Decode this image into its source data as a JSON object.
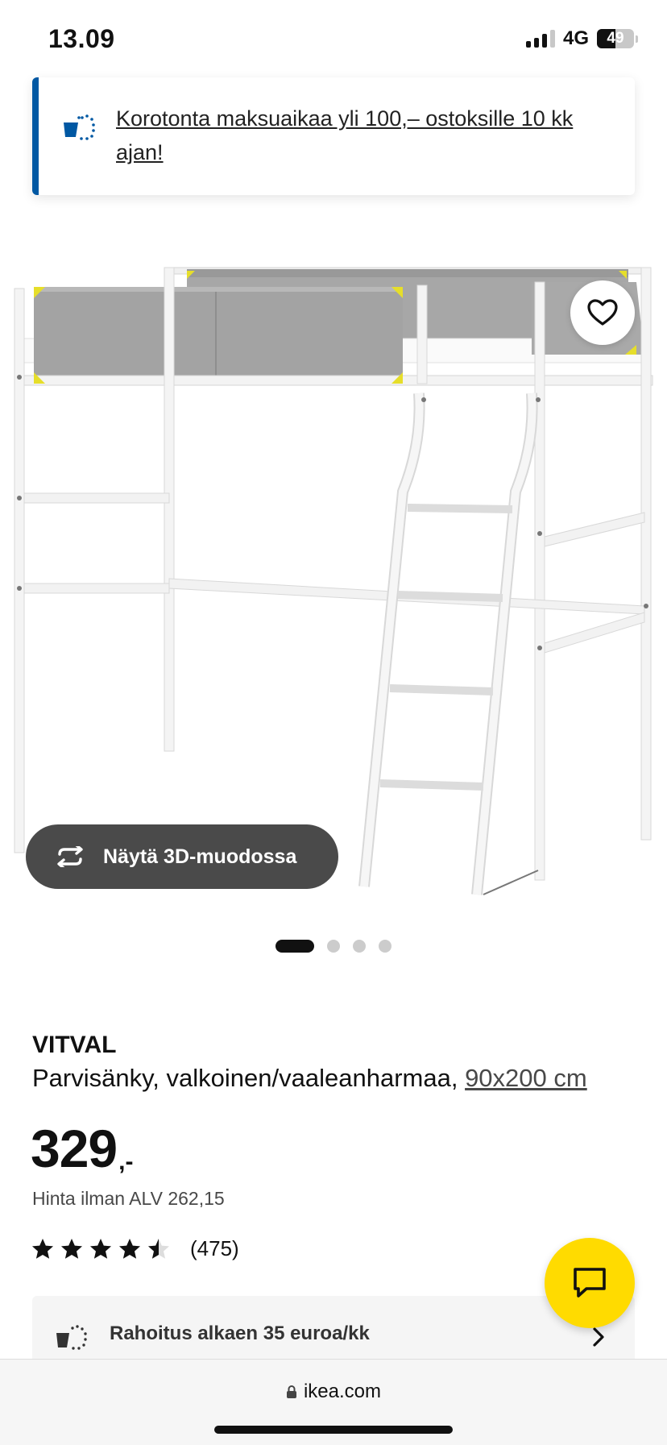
{
  "status_bar": {
    "time": "13.09",
    "network": "4G",
    "battery_level": "49",
    "battery_fraction": 0.49
  },
  "promo_banner": {
    "text": "Korotonta maksuaikaa yli 100,– ostoksille 10 kk ajan!",
    "icon": "payment-plan-icon",
    "accent_color": "#0058a3"
  },
  "product_image": {
    "favorite_icon": "heart-icon",
    "view_3d_label": "Näytä 3D-muodossa",
    "view_3d_icon": "rotate-3d-icon",
    "carousel": {
      "count": 4,
      "active_index": 0
    }
  },
  "product": {
    "name": "VITVAL",
    "description": "Parvisänky, valkoinen/vaaleanharmaa, ",
    "size_link": "90x200 cm",
    "price_main": "329",
    "price_suffix": ",-",
    "price_vat": "Hinta ilman ALV 262,15",
    "rating_value": 4.5,
    "rating_max": 5,
    "rating_count": "(475)"
  },
  "financing": {
    "label": "Rahoitus alkaen 35 euroa/kk",
    "icon": "payment-plan-icon"
  },
  "chat": {
    "icon": "chat-icon",
    "color": "#ffdb00"
  },
  "browser": {
    "url": "ikea.com"
  }
}
